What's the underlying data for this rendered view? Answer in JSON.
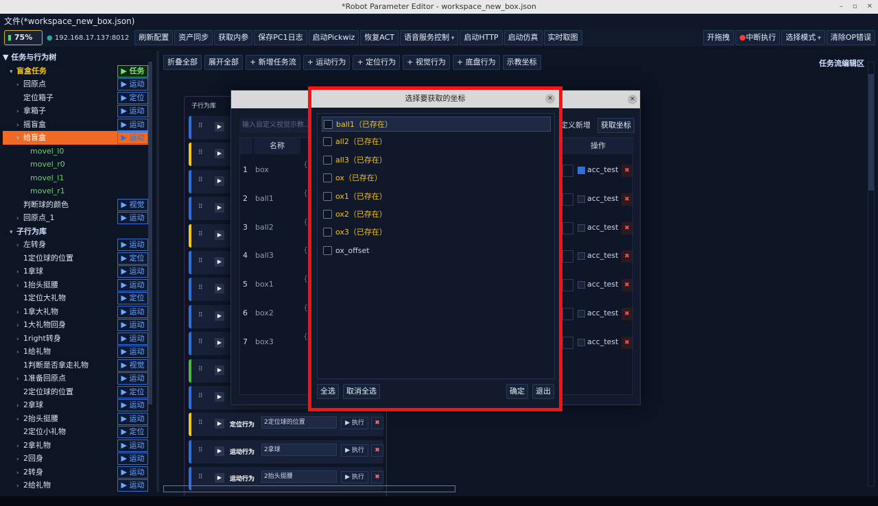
{
  "window": {
    "title": "*Robot Parameter Editor - workspace_new_box.json",
    "controls": [
      "–",
      "▫",
      "✕"
    ]
  },
  "menubar": {
    "file_label": "文件(*workspace_new_box.json)"
  },
  "toolbar": {
    "battery": "75%",
    "ip": "192.168.17.137:8012",
    "buttons": [
      "刷新配置",
      "资产同步",
      "获取内参",
      "保存PC1日志",
      "启动Pickwiz",
      "恢复ACT",
      "语音服务控制",
      "启动HTTP",
      "启动仿真",
      "实时取图"
    ],
    "right_buttons": [
      "开拖拽",
      "中断执行",
      "选择模式",
      "清除OP错误"
    ]
  },
  "tree": {
    "header": "▼ 任务与行为树",
    "rows": [
      {
        "indent": 1,
        "arrow": "▾",
        "label": "盲盒任务",
        "tag": "▶ 任务",
        "style": "yellow",
        "tagtype": "task"
      },
      {
        "indent": 2,
        "arrow": "›",
        "label": "回原点",
        "tag": "▶ 运动"
      },
      {
        "indent": 2,
        "arrow": "",
        "label": "定位箱子",
        "tag": "▶ 定位"
      },
      {
        "indent": 2,
        "arrow": "›",
        "label": "拿箱子",
        "tag": "▶ 运动"
      },
      {
        "indent": 2,
        "arrow": "›",
        "label": "摇盲盒",
        "tag": "▶ 运动"
      },
      {
        "indent": 2,
        "arrow": "▾",
        "label": "给盲盒",
        "tag": "▶ 运动",
        "style": "selected"
      },
      {
        "indent": 3,
        "arrow": "",
        "label": "movel_l0",
        "tag": "",
        "style": "green"
      },
      {
        "indent": 3,
        "arrow": "",
        "label": "movel_r0",
        "tag": "",
        "style": "green"
      },
      {
        "indent": 3,
        "arrow": "",
        "label": "movel_l1",
        "tag": "",
        "style": "green"
      },
      {
        "indent": 3,
        "arrow": "",
        "label": "movel_r1",
        "tag": "",
        "style": "green"
      },
      {
        "indent": 2,
        "arrow": "",
        "label": "判断球的颜色",
        "tag": "▶ 视觉"
      },
      {
        "indent": 2,
        "arrow": "›",
        "label": "回原点_1",
        "tag": "▶ 运动"
      },
      {
        "indent": 1,
        "arrow": "▾",
        "label": "子行为库",
        "tag": "",
        "style": "hdr"
      },
      {
        "indent": 2,
        "arrow": "›",
        "label": "左转身",
        "tag": "▶ 运动"
      },
      {
        "indent": 2,
        "arrow": "",
        "label": "1定位球的位置",
        "tag": "▶ 定位"
      },
      {
        "indent": 2,
        "arrow": "›",
        "label": "1拿球",
        "tag": "▶ 运动"
      },
      {
        "indent": 2,
        "arrow": "›",
        "label": "1抬头挺腰",
        "tag": "▶ 运动"
      },
      {
        "indent": 2,
        "arrow": "",
        "label": "1定位大礼物",
        "tag": "▶ 定位"
      },
      {
        "indent": 2,
        "arrow": "›",
        "label": "1拿大礼物",
        "tag": "▶ 运动"
      },
      {
        "indent": 2,
        "arrow": "›",
        "label": "1大礼物回身",
        "tag": "▶ 运动"
      },
      {
        "indent": 2,
        "arrow": "›",
        "label": "1right转身",
        "tag": "▶ 运动"
      },
      {
        "indent": 2,
        "arrow": "›",
        "label": "1给礼物",
        "tag": "▶ 运动"
      },
      {
        "indent": 2,
        "arrow": "",
        "label": "1判断是否拿走礼物",
        "tag": "▶ 视觉"
      },
      {
        "indent": 2,
        "arrow": "›",
        "label": "1准备回原点",
        "tag": "▶ 运动"
      },
      {
        "indent": 2,
        "arrow": "",
        "label": "2定位球的位置",
        "tag": "▶ 定位"
      },
      {
        "indent": 2,
        "arrow": "›",
        "label": "2拿球",
        "tag": "▶ 运动"
      },
      {
        "indent": 2,
        "arrow": "›",
        "label": "2抬头挺腰",
        "tag": "▶ 运动"
      },
      {
        "indent": 2,
        "arrow": "",
        "label": "2定位小礼物",
        "tag": "▶ 定位"
      },
      {
        "indent": 2,
        "arrow": "›",
        "label": "2拿礼物",
        "tag": "▶ 运动"
      },
      {
        "indent": 2,
        "arrow": "›",
        "label": "2回身",
        "tag": "▶ 运动"
      },
      {
        "indent": 2,
        "arrow": "›",
        "label": "2转身",
        "tag": "▶ 运动"
      },
      {
        "indent": 2,
        "arrow": "›",
        "label": "2给礼物",
        "tag": "▶ 运动"
      }
    ]
  },
  "flowbar": {
    "buttons": [
      "折叠全部",
      "展开全部",
      "+ 新增任务流",
      "+ 运动行为",
      "+ 定位行为",
      "+ 视觉行为",
      "+ 底盘行为",
      "示教坐标"
    ],
    "title": "任务流编辑区"
  },
  "sublib": {
    "title": "子行为库",
    "cards": [
      {
        "color": "#2f6fd6",
        "kind": "",
        "name": "",
        "exec": ""
      },
      {
        "color": "#f5c518",
        "kind": "",
        "name": "",
        "exec": ""
      },
      {
        "color": "#2f6fd6",
        "kind": "",
        "name": "",
        "exec": ""
      },
      {
        "color": "#2f6fd6",
        "kind": "",
        "name": "",
        "exec": ""
      },
      {
        "color": "#f5c518",
        "kind": "",
        "name": "",
        "exec": ""
      },
      {
        "color": "#2f6fd6",
        "kind": "",
        "name": "",
        "exec": ""
      },
      {
        "color": "#2f6fd6",
        "kind": "",
        "name": "",
        "exec": ""
      },
      {
        "color": "#2f6fd6",
        "kind": "",
        "name": "",
        "exec": ""
      },
      {
        "color": "#2f6fd6",
        "kind": "",
        "name": "",
        "exec": ""
      },
      {
        "color": "#4cb843",
        "kind": "",
        "name": "",
        "exec": ""
      },
      {
        "color": "#2f6fd6",
        "kind": "",
        "name": "",
        "exec": ""
      },
      {
        "color": "#f5c518",
        "kind": "定位行为",
        "name": "2定位球的位置",
        "exec": "▶ 执行"
      },
      {
        "color": "#2f6fd6",
        "kind": "运动行为",
        "name": "2拿球",
        "exec": "▶ 执行"
      },
      {
        "color": "#2f6fd6",
        "kind": "运动行为",
        "name": "2抬头挺腰",
        "exec": "▶ 执行"
      }
    ]
  },
  "bgdialog": {
    "input_placeholder": "输入自定义视觉示教...",
    "custom_add": "定义新增",
    "get_coord": "获取坐标",
    "headers": {
      "name": "名称",
      "op": "操作"
    },
    "rows": [
      {
        "idx": "1",
        "name": "box",
        "acc": "acc_test",
        "checked": true
      },
      {
        "idx": "2",
        "name": "ball1",
        "acc": "acc_test",
        "checked": false
      },
      {
        "idx": "3",
        "name": "ball2",
        "acc": "acc_test",
        "checked": false
      },
      {
        "idx": "4",
        "name": "ball3",
        "acc": "acc_test",
        "checked": false
      },
      {
        "idx": "5",
        "name": "box1",
        "acc": "acc_test",
        "checked": false
      },
      {
        "idx": "6",
        "name": "box2",
        "acc": "acc_test",
        "checked": false
      },
      {
        "idx": "7",
        "name": "box3",
        "acc": "acc_test",
        "checked": false
      }
    ]
  },
  "modal": {
    "title": "选择要获取的坐标",
    "options": [
      {
        "label": "ball1（已存在）",
        "exists": true
      },
      {
        "label": "all2（已存在）",
        "exists": true
      },
      {
        "label": "all3（已存在）",
        "exists": true
      },
      {
        "label": "ox（已存在）",
        "exists": true
      },
      {
        "label": "ox1（已存在）",
        "exists": true
      },
      {
        "label": "ox2（已存在）",
        "exists": true
      },
      {
        "label": "ox3（已存在）",
        "exists": true
      },
      {
        "label": "ox_offset",
        "exists": false
      }
    ],
    "select_all": "全选",
    "deselect_all": "取消全选",
    "confirm": "确定",
    "exit": "退出"
  }
}
